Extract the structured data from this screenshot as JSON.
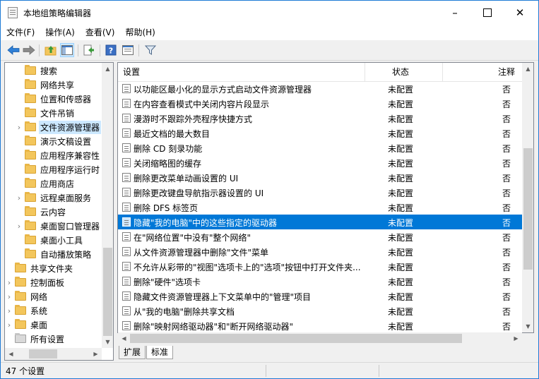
{
  "window": {
    "title": "本地组策略编辑器"
  },
  "menu": [
    "文件(F)",
    "操作(A)",
    "查看(V)",
    "帮助(H)"
  ],
  "tree": {
    "items": [
      {
        "label": "搜索",
        "level": 2,
        "expandable": false,
        "selected": false,
        "icon": "folder-icon"
      },
      {
        "label": "网络共享",
        "level": 2,
        "expandable": false,
        "selected": false,
        "icon": "folder-icon"
      },
      {
        "label": "位置和传感器",
        "level": 2,
        "expandable": false,
        "selected": false,
        "icon": "folder-icon"
      },
      {
        "label": "文件吊销",
        "level": 2,
        "expandable": false,
        "selected": false,
        "icon": "folder-icon"
      },
      {
        "label": "文件资源管理器",
        "level": 2,
        "expandable": true,
        "selected": true,
        "icon": "folder-icon"
      },
      {
        "label": "演示文稿设置",
        "level": 2,
        "expandable": false,
        "selected": false,
        "icon": "folder-icon"
      },
      {
        "label": "应用程序兼容性",
        "level": 2,
        "expandable": false,
        "selected": false,
        "icon": "folder-icon"
      },
      {
        "label": "应用程序运行时",
        "level": 2,
        "expandable": false,
        "selected": false,
        "icon": "folder-icon"
      },
      {
        "label": "应用商店",
        "level": 2,
        "expandable": false,
        "selected": false,
        "icon": "folder-icon"
      },
      {
        "label": "远程桌面服务",
        "level": 2,
        "expandable": true,
        "selected": false,
        "icon": "folder-icon"
      },
      {
        "label": "云内容",
        "level": 2,
        "expandable": false,
        "selected": false,
        "icon": "folder-icon"
      },
      {
        "label": "桌面窗口管理器",
        "level": 2,
        "expandable": true,
        "selected": false,
        "icon": "folder-icon"
      },
      {
        "label": "桌面小工具",
        "level": 2,
        "expandable": false,
        "selected": false,
        "icon": "folder-icon"
      },
      {
        "label": "自动播放策略",
        "level": 2,
        "expandable": false,
        "selected": false,
        "icon": "folder-icon"
      },
      {
        "label": "共享文件夹",
        "level": 1,
        "expandable": false,
        "selected": false,
        "icon": "folder-icon"
      },
      {
        "label": "控制面板",
        "level": 1,
        "expandable": true,
        "selected": false,
        "icon": "folder-icon"
      },
      {
        "label": "网络",
        "level": 1,
        "expandable": true,
        "selected": false,
        "icon": "folder-icon"
      },
      {
        "label": "系统",
        "level": 1,
        "expandable": true,
        "selected": false,
        "icon": "folder-icon"
      },
      {
        "label": "桌面",
        "level": 1,
        "expandable": true,
        "selected": false,
        "icon": "folder-icon"
      },
      {
        "label": "所有设置",
        "level": 1,
        "expandable": false,
        "selected": false,
        "icon": "settings-folder-icon"
      }
    ]
  },
  "list": {
    "columns": {
      "name": "设置",
      "state": "状态",
      "note": "注释"
    },
    "rows": [
      {
        "name": "以功能区最小化的显示方式启动文件资源管理器",
        "state": "未配置",
        "note": "否",
        "selected": false
      },
      {
        "name": "在内容查看模式中关闭内容片段显示",
        "state": "未配置",
        "note": "否",
        "selected": false
      },
      {
        "name": "漫游时不跟踪外壳程序快捷方式",
        "state": "未配置",
        "note": "否",
        "selected": false
      },
      {
        "name": "最近文档的最大数目",
        "state": "未配置",
        "note": "否",
        "selected": false
      },
      {
        "name": "删除 CD 刻录功能",
        "state": "未配置",
        "note": "否",
        "selected": false
      },
      {
        "name": "关闭缩略图的缓存",
        "state": "未配置",
        "note": "否",
        "selected": false
      },
      {
        "name": "删除更改菜单动画设置的 UI",
        "state": "未配置",
        "note": "否",
        "selected": false
      },
      {
        "name": "删除更改键盘导航指示器设置的 UI",
        "state": "未配置",
        "note": "否",
        "selected": false
      },
      {
        "name": "删除 DFS 标签页",
        "state": "未配置",
        "note": "否",
        "selected": false
      },
      {
        "name": "隐藏\"我的电脑\"中的这些指定的驱动器",
        "state": "未配置",
        "note": "否",
        "selected": true
      },
      {
        "name": "在\"网络位置\"中没有\"整个网络\"",
        "state": "未配置",
        "note": "否",
        "selected": false
      },
      {
        "name": "从文件资源管理器中删除\"文件\"菜单",
        "state": "未配置",
        "note": "否",
        "selected": false
      },
      {
        "name": "不允许从彩带的\"视图\"选项卡上的\"选项\"按钮中打开文件夹...",
        "state": "未配置",
        "note": "否",
        "selected": false
      },
      {
        "name": "删除\"硬件\"选项卡",
        "state": "未配置",
        "note": "否",
        "selected": false
      },
      {
        "name": "隐藏文件资源管理器上下文菜单中的\"管理\"项目",
        "state": "未配置",
        "note": "否",
        "selected": false
      },
      {
        "name": "从\"我的电脑\"删除共享文档",
        "state": "未配置",
        "note": "否",
        "selected": false
      },
      {
        "name": "删除\"映射网络驱动器\"和\"断开网络驱动器\"",
        "state": "未配置",
        "note": "否",
        "selected": false
      }
    ]
  },
  "tabs": [
    {
      "label": "扩展",
      "active": false
    },
    {
      "label": "标准",
      "active": true
    }
  ],
  "status": {
    "text": "47 个设置"
  }
}
